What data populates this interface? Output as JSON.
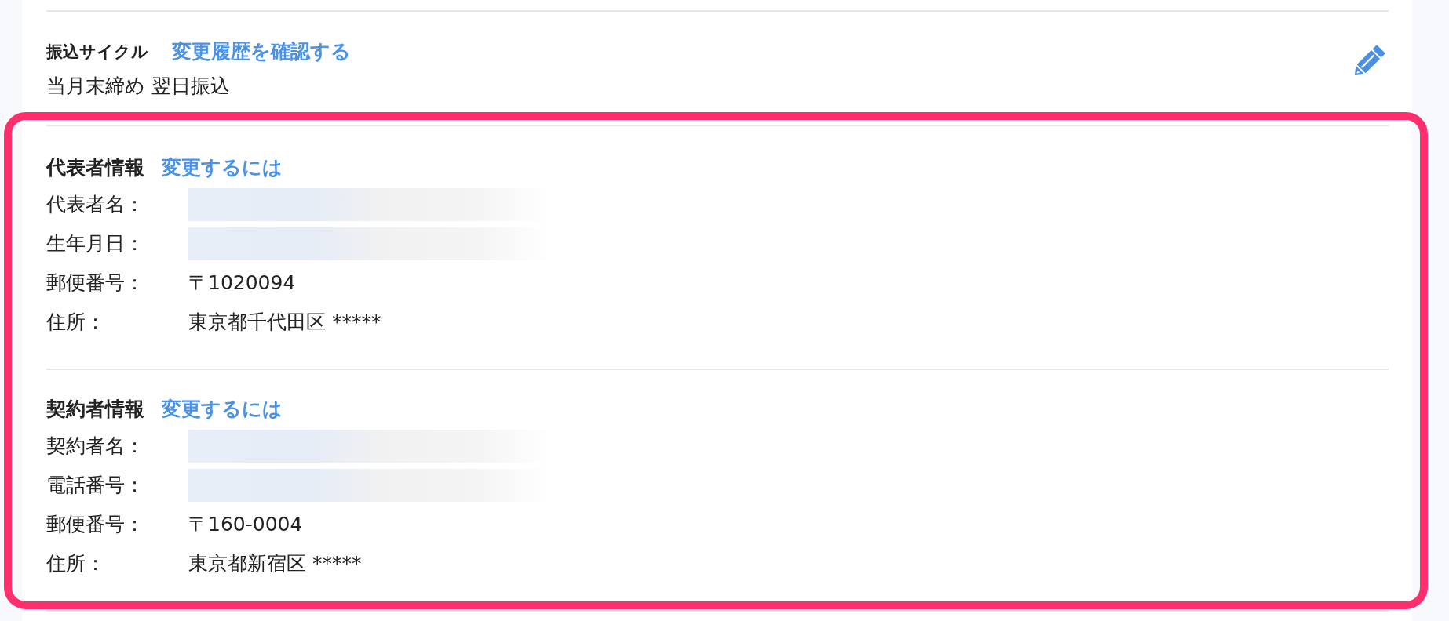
{
  "payout_cycle": {
    "label": "振込サイクル",
    "link": "変更履歴を確認する",
    "value": "当月末締め 翌日振込",
    "editable": true
  },
  "info_sections": {
    "highlighted": true,
    "items": [
      {
        "title": "代表者情報",
        "link": "変更するには",
        "rows": [
          {
            "label": "代表者名：",
            "redacted": true
          },
          {
            "label": "生年月日：",
            "redacted": true
          },
          {
            "label": "郵便番号：",
            "redacted": false,
            "value": "〒1020094"
          },
          {
            "label": "住所：",
            "redacted": false,
            "value": "東京都千代田区 *****"
          }
        ]
      },
      {
        "title": "契約者情報",
        "link": "変更するには",
        "rows": [
          {
            "label": "契約者名：",
            "redacted": true
          },
          {
            "label": "電話番号：",
            "redacted": true
          },
          {
            "label": "郵便番号：",
            "redacted": false,
            "value": "〒160-0004"
          },
          {
            "label": "住所：",
            "redacted": false,
            "value": "東京都新宿区 *****"
          }
        ]
      }
    ]
  }
}
